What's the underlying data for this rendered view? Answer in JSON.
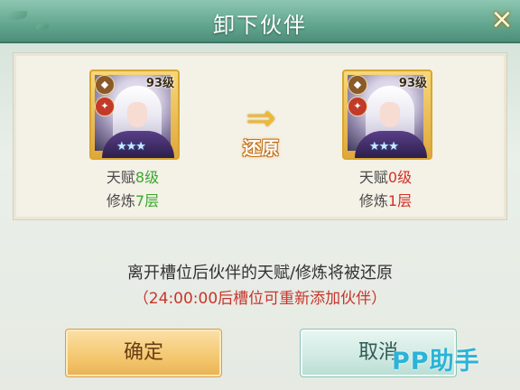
{
  "dialog": {
    "title": "卸下伙伴",
    "close_icon": "×"
  },
  "before": {
    "level": "93级",
    "stars": "★★★",
    "talent_label": "天赋",
    "talent_value": "8级",
    "train_label": "修炼",
    "train_value": "7层"
  },
  "after": {
    "level": "93级",
    "stars": "★★★",
    "talent_label": "天赋",
    "talent_value": "0级",
    "train_label": "修炼",
    "train_value": "1层"
  },
  "arrow_icon": "⇒",
  "restore_label": "还原",
  "message": {
    "line1": "离开槽位后伙伴的天赋/修炼将被还原",
    "line2": "（24:00:00后槽位可重新添加伙伴）"
  },
  "buttons": {
    "confirm": "确定",
    "cancel": "取消"
  },
  "watermark": "PP助手",
  "colors": {
    "accent_green": "#3aa830",
    "accent_red": "#d0302a",
    "title_bar": "#62a68f"
  }
}
